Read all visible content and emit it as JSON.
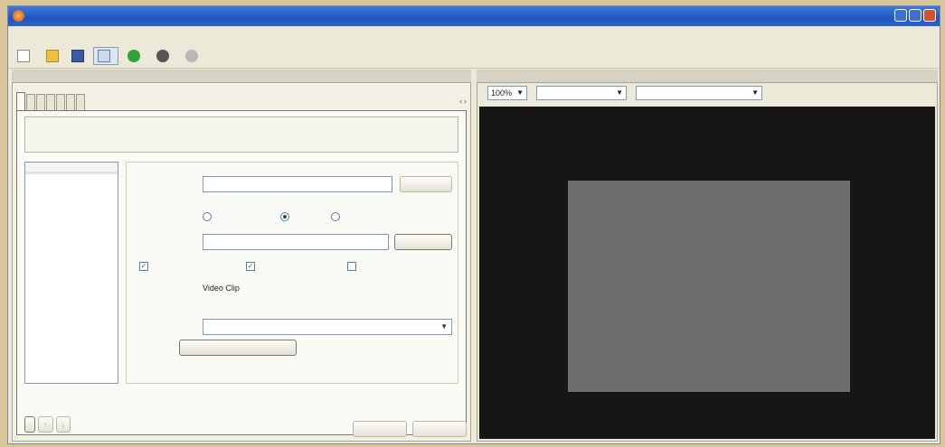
{
  "window": {
    "title": ""
  },
  "menu": {
    "items": [
      "",
      "",
      "",
      "",
      ""
    ]
  },
  "toolbar": {
    "new_session": "",
    "properties": "",
    "start_encoding": "",
    "stop": "",
    "pause": ""
  },
  "tabs": [
    "",
    "",
    "",
    "",
    "",
    "",
    ""
  ],
  "tab_nav": {
    "prev": "‹",
    "next": "›"
  },
  "source_tab": {
    "description": "",
    "list_header": "",
    "list_items": [
      ""
    ],
    "name_label": "",
    "name_value": "",
    "remove_button": "",
    "source_label": "",
    "source_options": [
      "",
      "",
      ""
    ],
    "source_selected_index": 1,
    "filename_label": "",
    "filename_value": "",
    "browse_button": "",
    "video_check": "",
    "audio_check": "",
    "script_check": "",
    "type_label": "",
    "type_value": "Video Clip",
    "size_label": "",
    "size_value": "",
    "input_label": "",
    "input_value": "",
    "configure_button": "",
    "archive_label": "",
    "archive_value": "",
    "add_button": "",
    "up_button": "↑",
    "down_button": "↓"
  },
  "footer": {
    "apply": "",
    "cancel": ""
  },
  "preview": {
    "zoom_label": "",
    "zoom_value": "100%",
    "image_label": "",
    "image_value": "",
    "view_label": "",
    "view_value": "",
    "no_preview_text": "",
    "frame_caption": ""
  },
  "colors": {
    "video_bg": "#161616",
    "frame_bg": "#6e6e6e",
    "title_bar": "#1e58c0"
  }
}
